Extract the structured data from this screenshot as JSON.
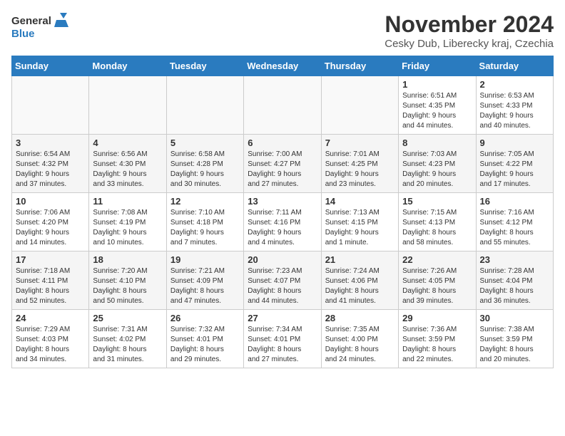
{
  "header": {
    "logo_line1": "General",
    "logo_line2": "Blue",
    "title": "November 2024",
    "subtitle": "Cesky Dub, Liberecky kraj, Czechia"
  },
  "weekdays": [
    "Sunday",
    "Monday",
    "Tuesday",
    "Wednesday",
    "Thursday",
    "Friday",
    "Saturday"
  ],
  "weeks": [
    [
      {
        "num": "",
        "info": ""
      },
      {
        "num": "",
        "info": ""
      },
      {
        "num": "",
        "info": ""
      },
      {
        "num": "",
        "info": ""
      },
      {
        "num": "",
        "info": ""
      },
      {
        "num": "1",
        "info": "Sunrise: 6:51 AM\nSunset: 4:35 PM\nDaylight: 9 hours\nand 44 minutes."
      },
      {
        "num": "2",
        "info": "Sunrise: 6:53 AM\nSunset: 4:33 PM\nDaylight: 9 hours\nand 40 minutes."
      }
    ],
    [
      {
        "num": "3",
        "info": "Sunrise: 6:54 AM\nSunset: 4:32 PM\nDaylight: 9 hours\nand 37 minutes."
      },
      {
        "num": "4",
        "info": "Sunrise: 6:56 AM\nSunset: 4:30 PM\nDaylight: 9 hours\nand 33 minutes."
      },
      {
        "num": "5",
        "info": "Sunrise: 6:58 AM\nSunset: 4:28 PM\nDaylight: 9 hours\nand 30 minutes."
      },
      {
        "num": "6",
        "info": "Sunrise: 7:00 AM\nSunset: 4:27 PM\nDaylight: 9 hours\nand 27 minutes."
      },
      {
        "num": "7",
        "info": "Sunrise: 7:01 AM\nSunset: 4:25 PM\nDaylight: 9 hours\nand 23 minutes."
      },
      {
        "num": "8",
        "info": "Sunrise: 7:03 AM\nSunset: 4:23 PM\nDaylight: 9 hours\nand 20 minutes."
      },
      {
        "num": "9",
        "info": "Sunrise: 7:05 AM\nSunset: 4:22 PM\nDaylight: 9 hours\nand 17 minutes."
      }
    ],
    [
      {
        "num": "10",
        "info": "Sunrise: 7:06 AM\nSunset: 4:20 PM\nDaylight: 9 hours\nand 14 minutes."
      },
      {
        "num": "11",
        "info": "Sunrise: 7:08 AM\nSunset: 4:19 PM\nDaylight: 9 hours\nand 10 minutes."
      },
      {
        "num": "12",
        "info": "Sunrise: 7:10 AM\nSunset: 4:18 PM\nDaylight: 9 hours\nand 7 minutes."
      },
      {
        "num": "13",
        "info": "Sunrise: 7:11 AM\nSunset: 4:16 PM\nDaylight: 9 hours\nand 4 minutes."
      },
      {
        "num": "14",
        "info": "Sunrise: 7:13 AM\nSunset: 4:15 PM\nDaylight: 9 hours\nand 1 minute."
      },
      {
        "num": "15",
        "info": "Sunrise: 7:15 AM\nSunset: 4:13 PM\nDaylight: 8 hours\nand 58 minutes."
      },
      {
        "num": "16",
        "info": "Sunrise: 7:16 AM\nSunset: 4:12 PM\nDaylight: 8 hours\nand 55 minutes."
      }
    ],
    [
      {
        "num": "17",
        "info": "Sunrise: 7:18 AM\nSunset: 4:11 PM\nDaylight: 8 hours\nand 52 minutes."
      },
      {
        "num": "18",
        "info": "Sunrise: 7:20 AM\nSunset: 4:10 PM\nDaylight: 8 hours\nand 50 minutes."
      },
      {
        "num": "19",
        "info": "Sunrise: 7:21 AM\nSunset: 4:09 PM\nDaylight: 8 hours\nand 47 minutes."
      },
      {
        "num": "20",
        "info": "Sunrise: 7:23 AM\nSunset: 4:07 PM\nDaylight: 8 hours\nand 44 minutes."
      },
      {
        "num": "21",
        "info": "Sunrise: 7:24 AM\nSunset: 4:06 PM\nDaylight: 8 hours\nand 41 minutes."
      },
      {
        "num": "22",
        "info": "Sunrise: 7:26 AM\nSunset: 4:05 PM\nDaylight: 8 hours\nand 39 minutes."
      },
      {
        "num": "23",
        "info": "Sunrise: 7:28 AM\nSunset: 4:04 PM\nDaylight: 8 hours\nand 36 minutes."
      }
    ],
    [
      {
        "num": "24",
        "info": "Sunrise: 7:29 AM\nSunset: 4:03 PM\nDaylight: 8 hours\nand 34 minutes."
      },
      {
        "num": "25",
        "info": "Sunrise: 7:31 AM\nSunset: 4:02 PM\nDaylight: 8 hours\nand 31 minutes."
      },
      {
        "num": "26",
        "info": "Sunrise: 7:32 AM\nSunset: 4:01 PM\nDaylight: 8 hours\nand 29 minutes."
      },
      {
        "num": "27",
        "info": "Sunrise: 7:34 AM\nSunset: 4:01 PM\nDaylight: 8 hours\nand 27 minutes."
      },
      {
        "num": "28",
        "info": "Sunrise: 7:35 AM\nSunset: 4:00 PM\nDaylight: 8 hours\nand 24 minutes."
      },
      {
        "num": "29",
        "info": "Sunrise: 7:36 AM\nSunset: 3:59 PM\nDaylight: 8 hours\nand 22 minutes."
      },
      {
        "num": "30",
        "info": "Sunrise: 7:38 AM\nSunset: 3:59 PM\nDaylight: 8 hours\nand 20 minutes."
      }
    ]
  ]
}
